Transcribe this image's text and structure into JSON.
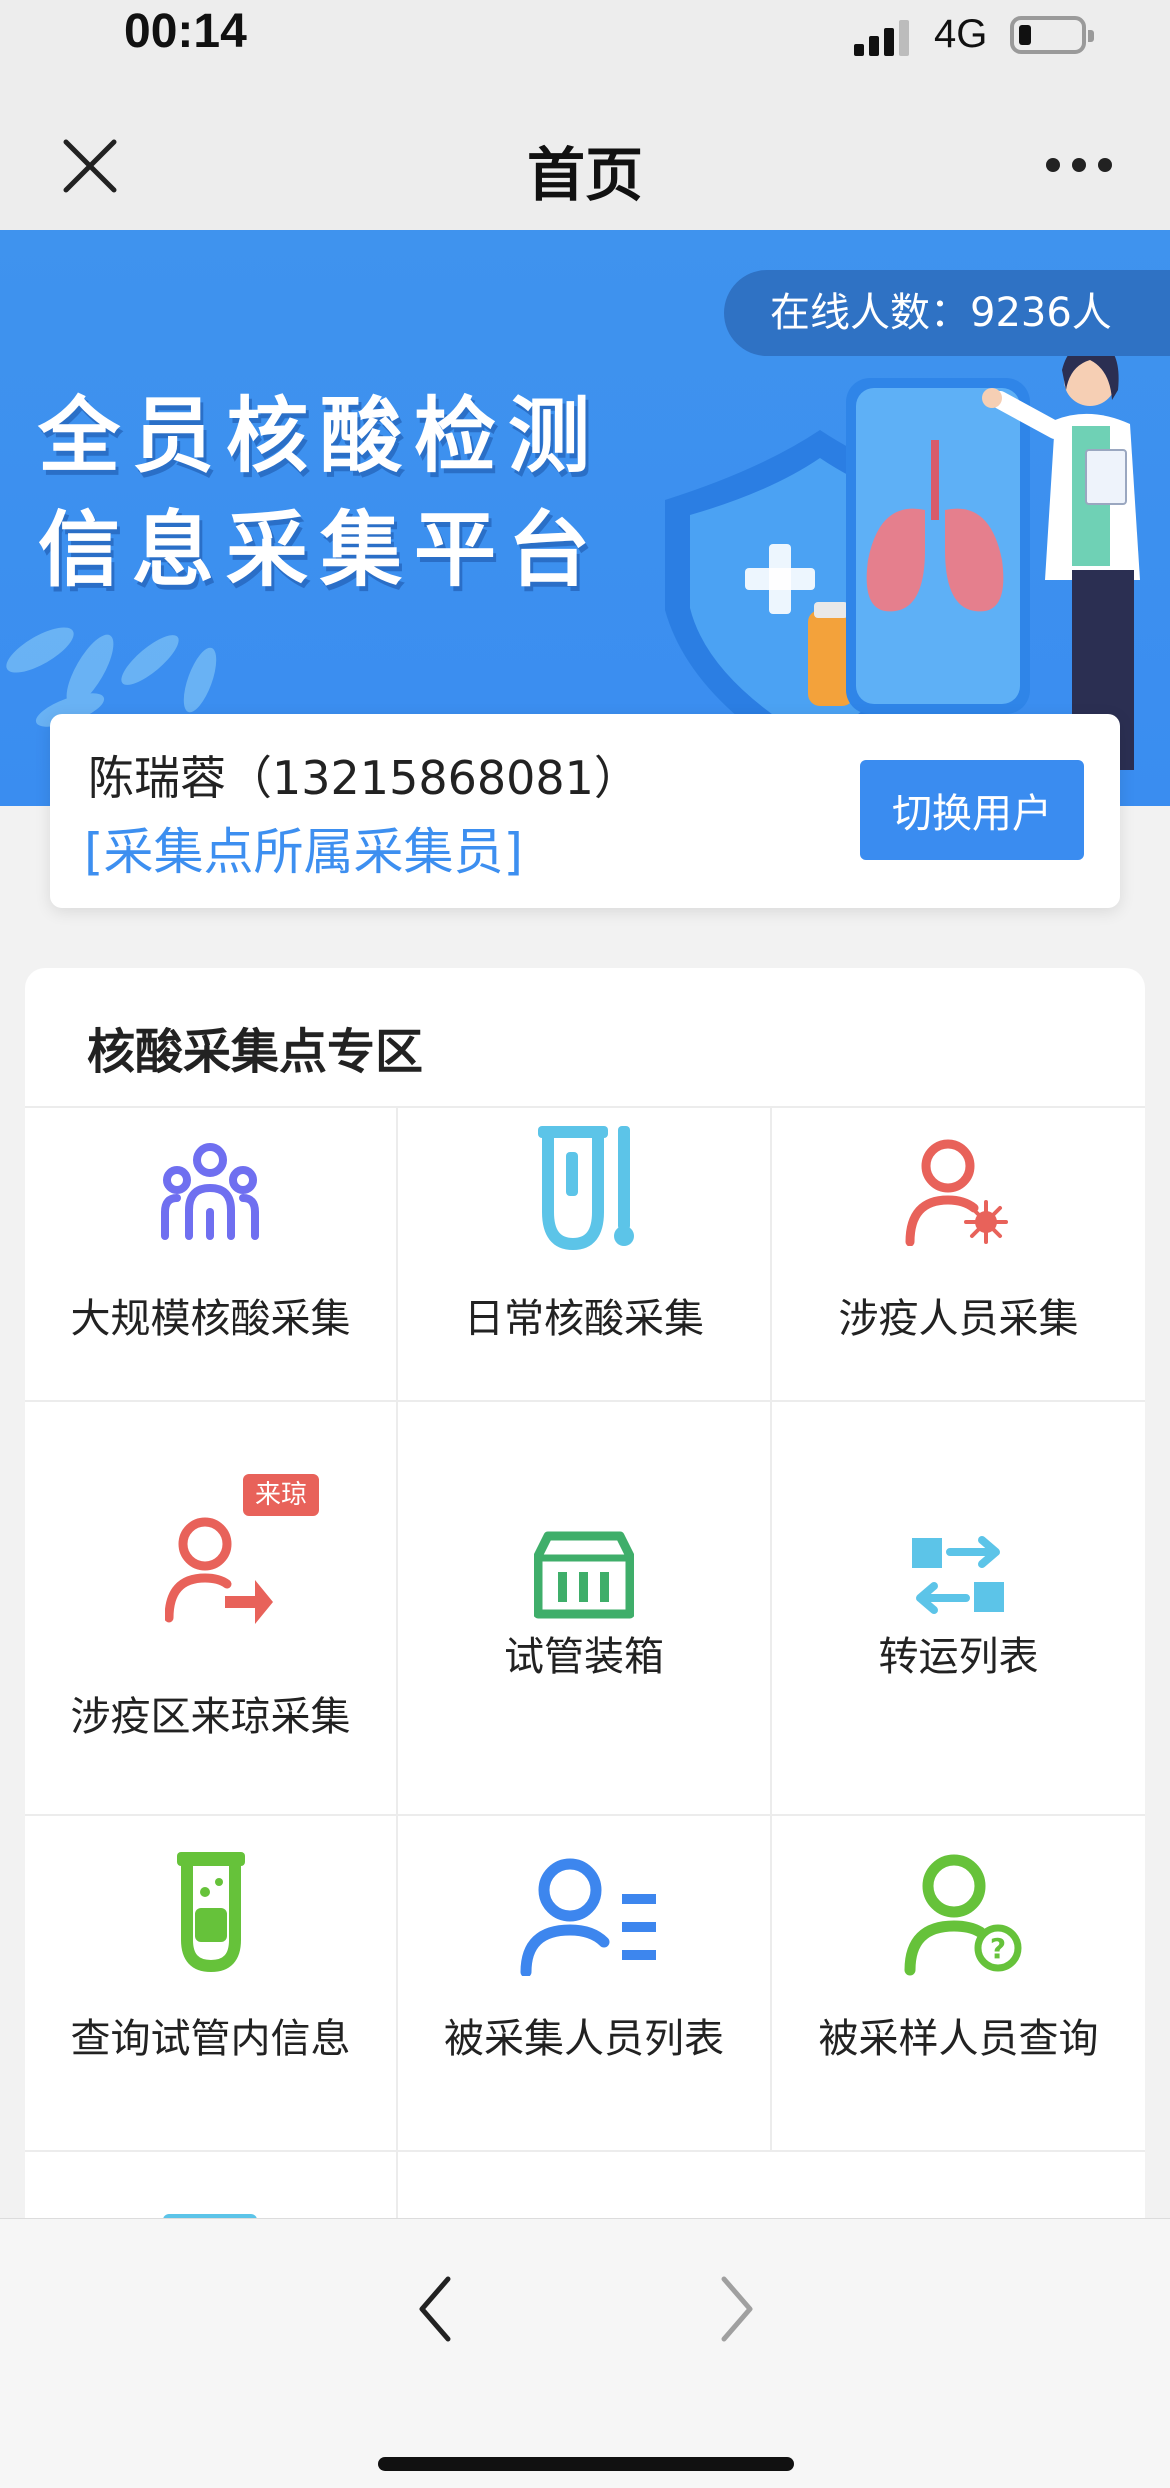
{
  "status_bar": {
    "time": "00:14",
    "network": "4G",
    "battery_level": 0.2
  },
  "nav": {
    "title": "首页"
  },
  "banner": {
    "online_label": "在线人数：9236人",
    "title_line1": "全员核酸检测",
    "title_line2": "信息采集平台"
  },
  "user": {
    "name": "陈瑞蓉（13215868081）",
    "role": "[采集点所属采集员]",
    "switch_label": "切换用户"
  },
  "section": {
    "title": "核酸采集点专区",
    "items": [
      {
        "label": "大规模核酸采集",
        "icon": "group-icon"
      },
      {
        "label": "日常核酸采集",
        "icon": "test-tube-swab-icon"
      },
      {
        "label": "涉疫人员采集",
        "icon": "person-virus-icon"
      },
      {
        "label": "涉疫区来琼采集",
        "icon": "person-arrow-icon",
        "badge": "来琼"
      },
      {
        "label": "试管装箱",
        "icon": "box-icon"
      },
      {
        "label": "转运列表",
        "icon": "transfer-icon"
      },
      {
        "label": "查询试管内信息",
        "icon": "test-tube-icon"
      },
      {
        "label": "被采集人员列表",
        "icon": "person-list-icon"
      },
      {
        "label": "被采样人员查询",
        "icon": "person-question-icon"
      }
    ]
  },
  "colors": {
    "primary": "#3a8cf0",
    "banner": "#3f93ee",
    "purple": "#6f6ff0",
    "cyan": "#5cc4e8",
    "red": "#e8625a",
    "green": "#3fae6a",
    "lime": "#66c23a",
    "blue": "#3d86ee"
  }
}
